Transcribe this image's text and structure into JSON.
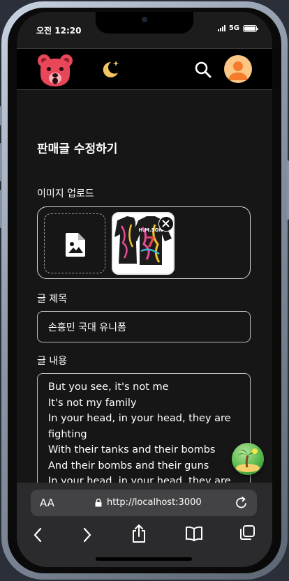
{
  "status_bar": {
    "time": "오전 12:20",
    "network": "5G"
  },
  "header": {
    "logo_icon": "bear-face-logo",
    "theme_icon": "moon-sparkle-icon",
    "search_icon": "search-icon",
    "avatar_icon": "user-avatar-icon"
  },
  "page": {
    "title": "판매글 수정하기",
    "image_label": "이미지 업로드",
    "title_label": "글 제목",
    "title_value": "손흥민 국대 유니폼",
    "content_label": "글 내용",
    "content_value": "But you see, it's not me\nIt's not my family\nIn your head, in your head, they are fighting\nWith their tanks and their bombs\nAnd their bombs and their guns\nIn your head, in your head, they are crying",
    "uploaded_image": {
      "jersey_name": "H.M.SON",
      "jersey_number": "7"
    }
  },
  "browser": {
    "reader_label": "AA",
    "url": "http://localhost:3000"
  },
  "colors": {
    "accent_bear": "#e8475a",
    "avatar_bg": "#fcc685",
    "moon": "#f5c660"
  }
}
